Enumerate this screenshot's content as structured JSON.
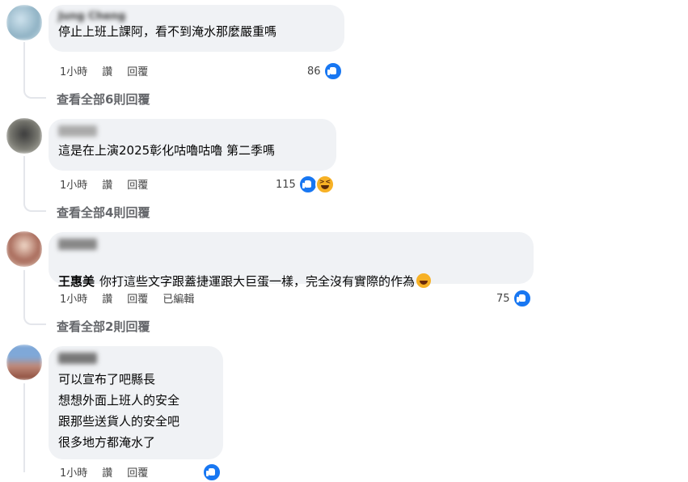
{
  "comments": [
    {
      "author": "Jung Cheng",
      "text": "停止上班上課阿，看不到淹水那麼嚴重嗎",
      "time": "1小時",
      "like_label": "讚",
      "reply_label": "回覆",
      "reaction_count": "86",
      "view_replies": "查看全部6則回覆"
    },
    {
      "author": "",
      "text": "這是在上演2025彰化咕嚕咕嚕 第二季嗎",
      "time": "1小時",
      "like_label": "讚",
      "reply_label": "回覆",
      "reaction_count": "115",
      "view_replies": "查看全部4則回覆"
    },
    {
      "author": "",
      "tag": "王惠美",
      "text": "你打這些文字跟蓋捷運跟大巨蛋一樣，完全沒有實際的作為",
      "time": "1小時",
      "like_label": "讚",
      "reply_label": "回覆",
      "edited_label": "已編輯",
      "reaction_count": "75",
      "view_replies": "查看全部2則回覆"
    },
    {
      "author": "",
      "text": "可以宣布了吧縣長\n想想外面上班人的安全\n跟那些送貨人的安全吧\n很多地方都淹水了",
      "time": "1小時",
      "like_label": "讚",
      "reply_label": "回覆"
    }
  ],
  "colors": {
    "bubble": "#f0f2f5",
    "like": "#1877f2",
    "muted": "#65676b"
  },
  "icons": [
    "like-icon",
    "haha-icon"
  ]
}
